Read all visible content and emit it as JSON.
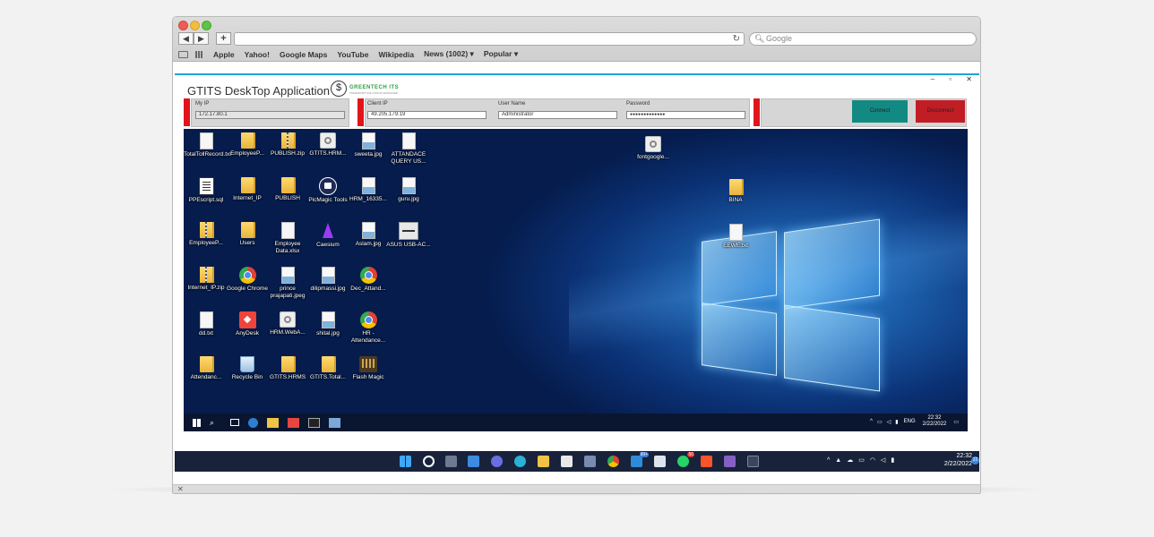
{
  "browser": {
    "search_placeholder": "Google",
    "bookmarks": [
      "Apple",
      "Yahoo!",
      "Google Maps",
      "YouTube",
      "Wikipedia",
      "News (1002) ▾",
      "Popular ▾"
    ]
  },
  "app": {
    "title": "GTITS DeskTop Application",
    "logo_text": "GREENTECH ITS",
    "logo_subtext": "TRANSPORT SOLUTIONS SIMPLIFIED",
    "window_controls": "– ▫ ✕",
    "fields": {
      "my_ip_label": "My IP",
      "my_ip_value": "172.17.80.1",
      "client_ip_label": "Client IP",
      "client_ip_value": "49.205.179.19",
      "user_name_label": "User Name",
      "user_name_value": "Administrator",
      "password_label": "Password",
      "password_value": "●●●●●●●●●●●●●"
    },
    "connect_label": "Connect",
    "disconnect_label": "Disconnect",
    "colors": {
      "connect": "#128a82",
      "disconnect": "#c01e24",
      "accent": "#1ea4d7",
      "marker": "#e2141a"
    }
  },
  "remote_desktop": {
    "icons": [
      {
        "label": "TotalTollRecord.txt",
        "type": "doc"
      },
      {
        "label": "EmployeeP...",
        "type": "folder"
      },
      {
        "label": "PUBLISH.zip",
        "type": "zip"
      },
      {
        "label": "GTITS.HRM...",
        "type": "gear"
      },
      {
        "label": "sweeta.jpg",
        "type": "img"
      },
      {
        "label": "ATTANDACE QUERY US...",
        "type": "doc"
      },
      {
        "label": "PPEscript.sql",
        "type": "script"
      },
      {
        "label": "Internet_IP",
        "type": "folder"
      },
      {
        "label": "PUBLISH",
        "type": "folder"
      },
      {
        "label": "PicMagic Tools",
        "type": "picmagic"
      },
      {
        "label": "HRM_16335...",
        "type": "img"
      },
      {
        "label": "guru.jpg",
        "type": "img"
      },
      {
        "label": "EmployeeP...",
        "type": "zip"
      },
      {
        "label": "Users",
        "type": "folder"
      },
      {
        "label": "Employee Data.xlsx",
        "type": "doc"
      },
      {
        "label": "Caesium",
        "type": "caesium"
      },
      {
        "label": "Aslam.jpg",
        "type": "img"
      },
      {
        "label": "ASUS USB-AC...",
        "type": "usb"
      },
      {
        "label": "Internet_IP.zip",
        "type": "zip"
      },
      {
        "label": "Google Chrome",
        "type": "chrome"
      },
      {
        "label": "prince prajapati.jpeg",
        "type": "img"
      },
      {
        "label": "dilipmassi.jpg",
        "type": "img"
      },
      {
        "label": "Dec_Attand...",
        "type": "chrome"
      },
      {
        "label": "dd.txt",
        "type": "doc"
      },
      {
        "label": "AnyDesk",
        "type": "anydesk"
      },
      {
        "label": "HRM.WebA...",
        "type": "gear"
      },
      {
        "label": "shital.jpg",
        "type": "img"
      },
      {
        "label": "HR - Attendance...",
        "type": "chrome"
      },
      {
        "label": "Attendanc...",
        "type": "folder"
      },
      {
        "label": "Recycle Bin",
        "type": "recycle"
      },
      {
        "label": "GTITS.HRMS",
        "type": "folder"
      },
      {
        "label": "GTITS.Total...",
        "type": "folder"
      },
      {
        "label": "Flash Magic",
        "type": "flash"
      },
      {
        "label": "fontgoogle...",
        "type": "gear"
      },
      {
        "label": "BINA",
        "type": "folder"
      },
      {
        "label": "EEWE.txt",
        "type": "doc"
      }
    ],
    "tray": {
      "lang": "ENG",
      "time": "22:32",
      "date": "2/22/2022"
    }
  },
  "local_taskbar": {
    "time": "22:32",
    "date": "2/22/2022",
    "badge_mail": "99+",
    "badge_whatsapp": "50",
    "badge_notify": "22"
  }
}
